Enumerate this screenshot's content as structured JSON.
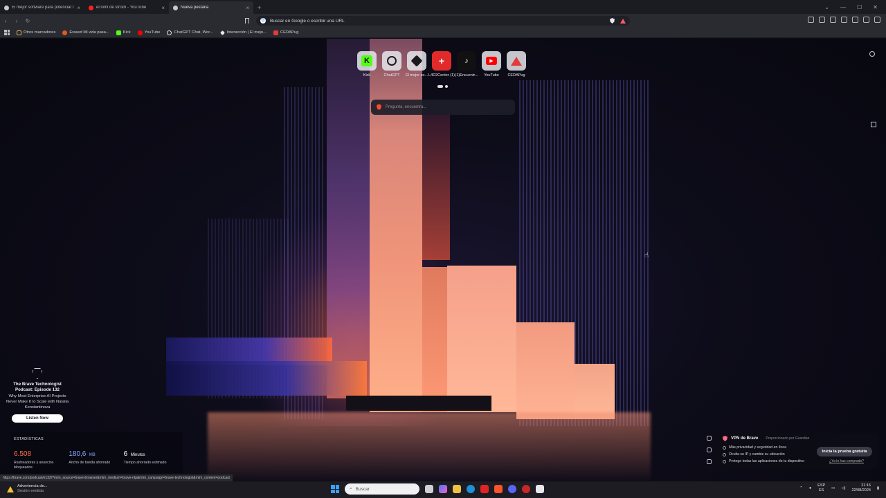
{
  "tabs": [
    {
      "title": "El mejor software para potenciar tu c...",
      "favicon_color": "#c9cad0",
      "active": false
    },
    {
      "title": "el loml de strckh - YouTube",
      "favicon_color": "#ff2020",
      "active": false
    },
    {
      "title": "Nueva pestaña",
      "favicon_color": "#c9cad0",
      "active": true
    }
  ],
  "omnibox": {
    "placeholder": "Buscar en Google o escribir una URL"
  },
  "bookmarks": [
    {
      "label": "Otros marcadores",
      "icon": "folder-icon",
      "color": "#d9b45a"
    },
    {
      "label": "Erased Mi vida pasa...",
      "icon": "site-icon",
      "color": "#e05a1e"
    },
    {
      "label": "Kick",
      "icon": "kick-icon",
      "color": "#53fc18"
    },
    {
      "label": "YouTube",
      "icon": "youtube-icon",
      "color": "#ff0000"
    },
    {
      "label": "ChatGPT Chat, Wor...",
      "icon": "chatgpt-icon",
      "color": "#e6e6e6"
    },
    {
      "label": "Interacción | El mejo...",
      "icon": "site-icon",
      "color": "#e6e6e6"
    },
    {
      "label": "CEDAPug",
      "icon": "cedapug-icon",
      "color": "#e33b3b"
    }
  ],
  "topsites": [
    {
      "label": "Kick",
      "icon": "kick-icon",
      "color": "#53fc18"
    },
    {
      "label": "ChatGPT",
      "icon": "chatgpt-icon",
      "color": "#1a1a1a"
    },
    {
      "label": "El mejor so...",
      "icon": "site-icon",
      "color": "#1a1a1a"
    },
    {
      "label": "L4D2Center (1)",
      "icon": "l4d2-icon",
      "color": "#e12b2b"
    },
    {
      "label": "(1)Encuentr...",
      "icon": "tiktok-icon",
      "color": "#111111"
    },
    {
      "label": "YouTube",
      "icon": "youtube-icon",
      "color": "#ff0000"
    },
    {
      "label": "CEDAPug",
      "icon": "cedapug-icon",
      "color": "#e33b3b"
    }
  ],
  "search": {
    "placeholder": "Pregunta, encuentra..."
  },
  "podcast": {
    "title": "The Brave Technologist Podcast: Episode 132",
    "description": "Why Most Enterprise AI Projects Never Make It to Scale with Natalia Konstantinova",
    "button": "Listen Now"
  },
  "stats": {
    "heading": "ESTADÍSTICAS",
    "items": [
      {
        "value": "6.508",
        "unit": "",
        "label": "Rastreadores y anuncios bloqueados",
        "color": "#ff6b4a"
      },
      {
        "value": "180,6",
        "unit": "MB",
        "label": "Ancho de banda ahorrado",
        "color": "#8ea7ff"
      },
      {
        "value": "6",
        "unit": "Minutos",
        "label": "Tiempo ahorrado estimado",
        "color": "#ffffff"
      }
    ]
  },
  "vpn": {
    "title": "VPN de Brave",
    "provider": "Proporcionado por Guardian",
    "features": [
      "Más privacidad y seguridad en línea",
      "Oculta su IP y cambie su ubicación",
      "Protege todas las aplicaciones de tu dispositivo"
    ],
    "cta": "Inicia la prueba gratuita",
    "link": "¿Ya lo has comprado?"
  },
  "status_url": "https://brave.com/podcast/e132/?mtm_source=brave-browser&mtm_medium=brave-ntp&mtm_campaign=brave-technologist&mtm_content=podcast",
  "taskbar": {
    "warning_title": "Advertencia de...",
    "warning_sub": "Sesión emitida",
    "search_placeholder": "Buscar",
    "lang": "ESP",
    "lang_sub": "ES",
    "time": "21:16",
    "date": "22/08/2024"
  }
}
